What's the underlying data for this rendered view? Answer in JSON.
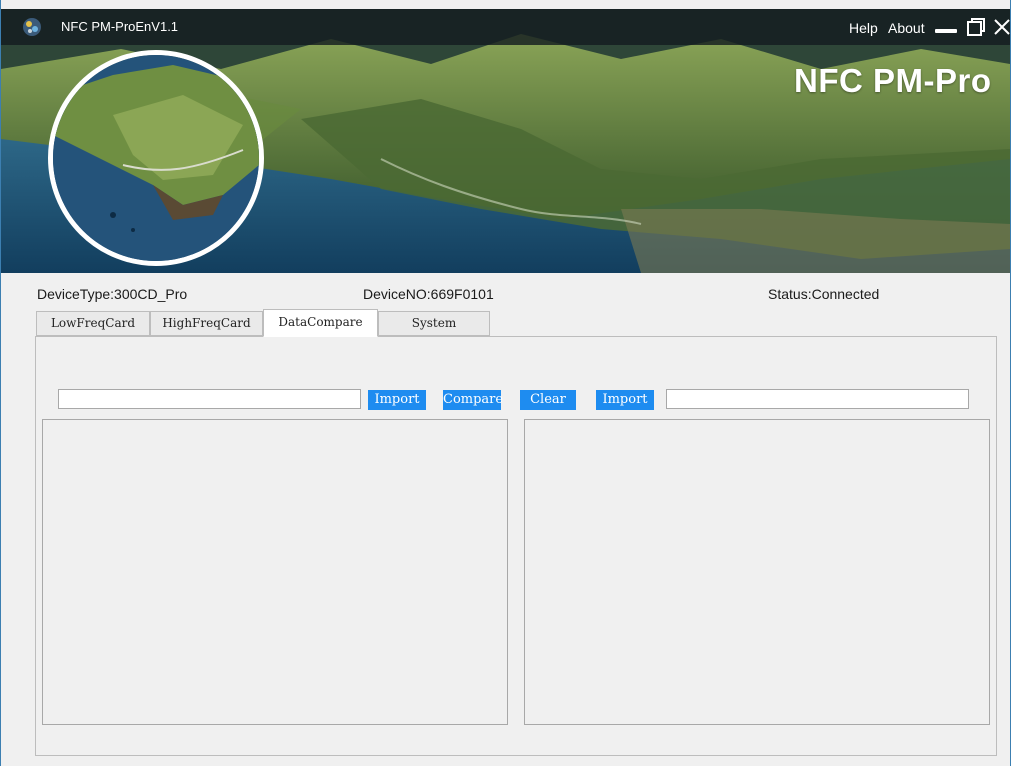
{
  "window": {
    "title": "NFC PM-ProEnV1.1",
    "menu": {
      "help": "Help",
      "about": "About"
    },
    "brand": "NFC PM-Pro"
  },
  "info": {
    "device_type": "DeviceType:300CD_Pro",
    "device_no": "DeviceNO:669F0101",
    "status": "Status:Connected"
  },
  "tabs": [
    {
      "label": "LowFreqCard",
      "active": false
    },
    {
      "label": "HighFreqCard",
      "active": false
    },
    {
      "label": "DataCompare",
      "active": true
    },
    {
      "label": "System",
      "active": false
    }
  ],
  "compare": {
    "left_path": "",
    "right_path": "",
    "buttons": {
      "import_left": "Import",
      "compare": "Compare",
      "clear": "Clear",
      "import_right": "Import"
    },
    "left_content": "",
    "right_content": ""
  },
  "colors": {
    "button": "#1e8cf0",
    "titlebar": "#141c20",
    "window_bg": "#f0f0f0"
  },
  "icons": [
    "app-icon",
    "minimize-icon",
    "maximize-icon",
    "close-icon"
  ]
}
